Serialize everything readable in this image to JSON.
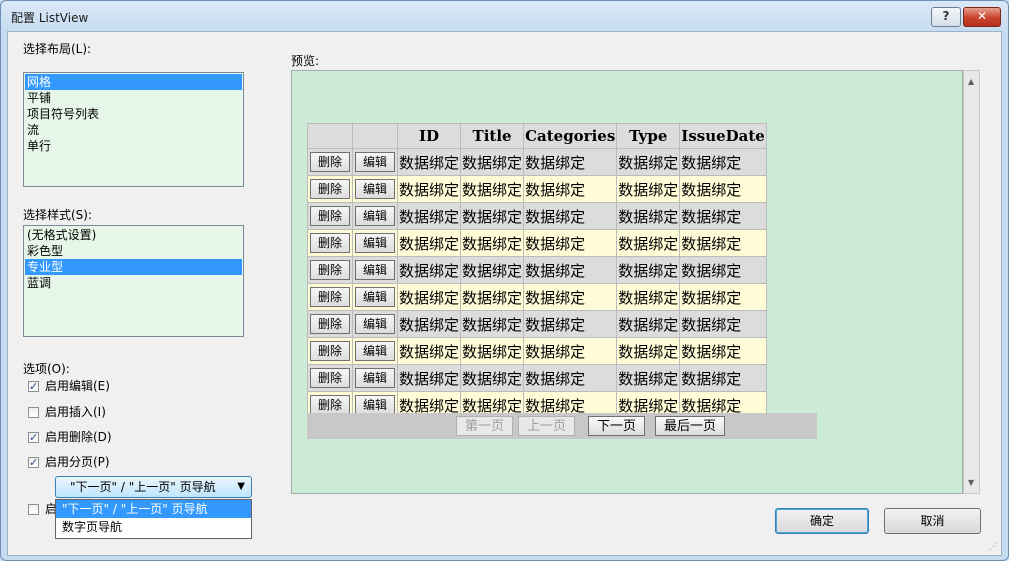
{
  "window": {
    "title": "配置 ListView",
    "help": "?",
    "close": "✕"
  },
  "layout_label": "选择布局(L):",
  "layout_items": [
    "网格",
    "平铺",
    "项目符号列表",
    "流",
    "单行"
  ],
  "style_label": "选择样式(S):",
  "style_items": [
    "(无格式设置)",
    "彩色型",
    "专业型",
    "蓝调"
  ],
  "options_label": "选项(O):",
  "options": [
    {
      "label": "启用编辑(E)",
      "checked": true
    },
    {
      "label": "启用插入(I)",
      "checked": false
    },
    {
      "label": "启用删除(D)",
      "checked": true
    },
    {
      "label": "启用分页(P)",
      "checked": true
    }
  ],
  "dynamic_option": {
    "label": "启",
    "checked": false
  },
  "paging_combo": {
    "value": "\"下一页\" / \"上一页\" 页导航",
    "arrow": "▼",
    "options": [
      "\"下一页\" / \"上一页\" 页导航",
      "数字页导航"
    ]
  },
  "preview": {
    "label": "预览:",
    "headers": [
      "",
      "",
      "ID",
      "Title",
      "Categories",
      "Type",
      "IssueDate"
    ],
    "delete_label": "删除",
    "edit_label": "编辑",
    "cell_text": "数据绑定",
    "row_count": 10,
    "pager": [
      "第一页",
      "上一页",
      "下一页",
      "最后一页"
    ]
  },
  "buttons": {
    "ok": "确定",
    "cancel": "取消"
  },
  "icons": {
    "up": "▲",
    "down": "▼",
    "grip": "⋰"
  }
}
